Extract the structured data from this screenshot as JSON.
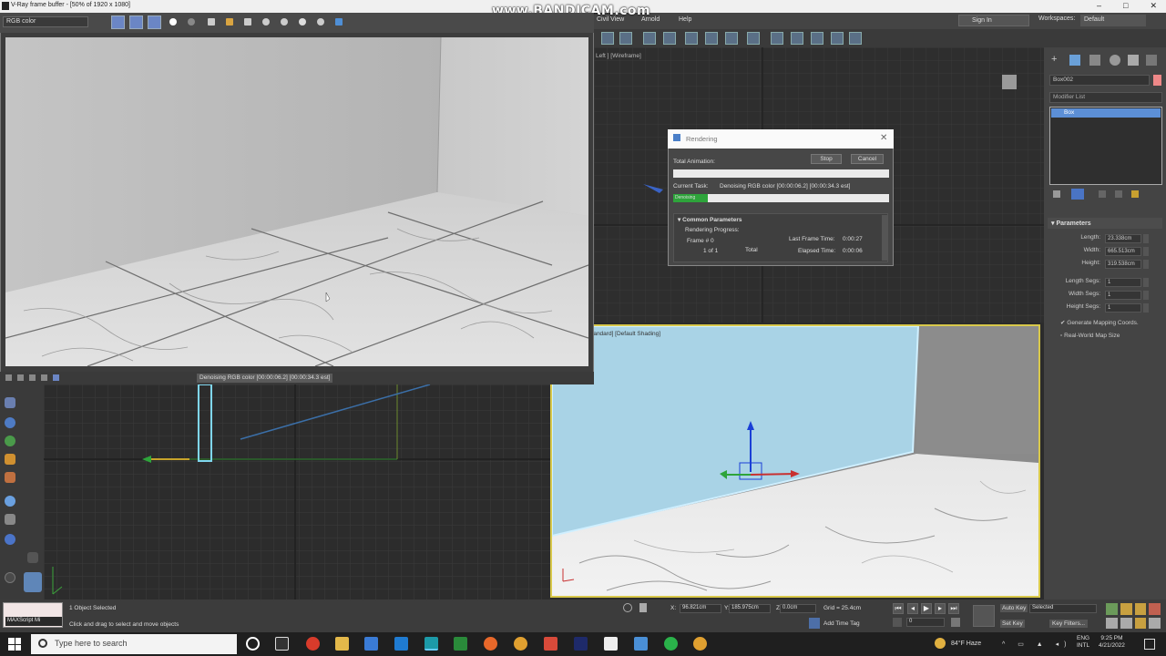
{
  "titlebar": {
    "vfb_title": "V-Ray frame buffer - [50% of 1920 x 1080]",
    "watermark": "www.BANDICAM.com",
    "menus": [
      "Civil View",
      "Arnold",
      "Help"
    ],
    "sign_in": "Sign In",
    "workspaces_label": "Workspaces:",
    "workspace_value": "Default",
    "window_controls": [
      "–",
      "□",
      "✕"
    ]
  },
  "vfb": {
    "channel": "RGB color",
    "status": "Denoising RGB color [00:00:06.2] [00:00:34.3 est]"
  },
  "viewports": {
    "top_label": "Left ] [Wireframe]",
    "persp_label": "Perspective ] [Standard] [Default Shading]"
  },
  "rendering_dialog": {
    "title": "Rendering",
    "total_animation_label": "Total Animation:",
    "stop_label": "Stop",
    "cancel_label": "Cancel",
    "current_task_label": "Current Task:",
    "current_task_value": "Denoising RGB color [00:00:06.2] [00:00:34.3 est]",
    "progress_label": "Denoising",
    "total_progress": 0,
    "task_progress": 0.16,
    "section_title": "Common Parameters",
    "rendering_progress_label": "Rendering Progress:",
    "frame_label": "Frame #",
    "frame_value": "0",
    "last_frame_time_label": "Last Frame Time:",
    "last_frame_time_value": "0:00:27",
    "of_label": "1 of 1",
    "total_label": "Total",
    "elapsed_label": "Elapsed Time:",
    "elapsed_value": "0:00:06"
  },
  "command_panel": {
    "object_name": "Box002",
    "modifier_list": "Modifier List",
    "stack_item": "Box",
    "params_title": "Parameters",
    "params": [
      {
        "label": "Length:",
        "value": "23.338cm"
      },
      {
        "label": "Width:",
        "value": "665.513cm"
      },
      {
        "label": "Height:",
        "value": "319.538cm"
      },
      {
        "label": "Length Segs:",
        "value": "1"
      },
      {
        "label": "Width Segs:",
        "value": "1"
      },
      {
        "label": "Height Segs:",
        "value": "1"
      }
    ],
    "gen_mapping": "Generate Mapping Coords.",
    "real_world": "Real-World Map Size"
  },
  "status": {
    "maxscript": "MAXScript Mi",
    "selected": "1 Object Selected",
    "prompt": "Click and drag to select and move objects",
    "x_value": "96.821cm",
    "y_value": "185.975cm",
    "z_value": "0.0cm",
    "grid": "Grid = 25.4cm",
    "add_time_tag": "Add Time Tag",
    "auto_key": "Auto Key",
    "set_key": "Set Key",
    "selected_dd": "Selected",
    "key_filters": "Key Filters...",
    "frame": "0"
  },
  "taskbar": {
    "search_placeholder": "Type here to search",
    "weather": "84°F Haze",
    "lang1": "ENG",
    "lang2": "INTL",
    "time": "9:25 PM",
    "date": "4/21/2022"
  }
}
